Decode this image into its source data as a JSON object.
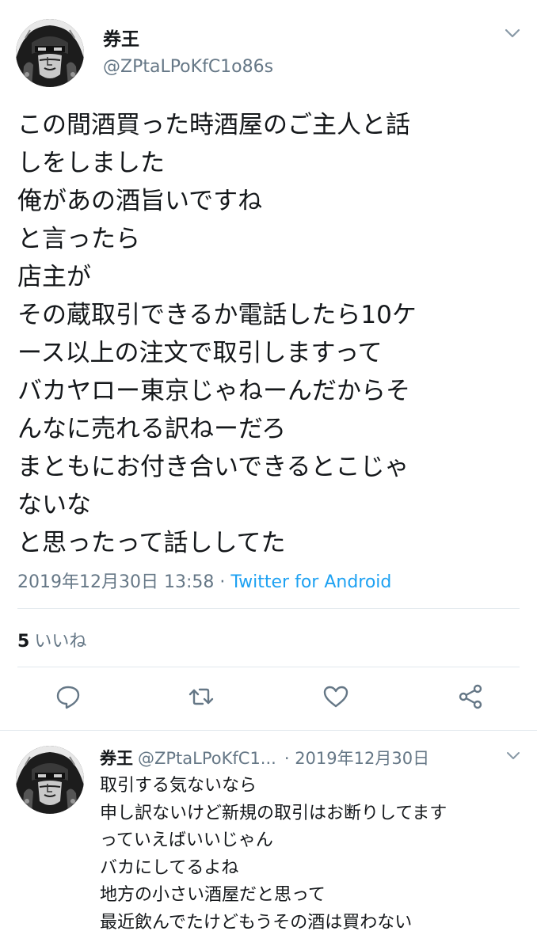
{
  "tweet": {
    "author": {
      "name": "券王",
      "handle": "@ZPtaLPoKfC1o86s"
    },
    "text_lines": [
      "この間酒買った時酒屋のご主人と話",
      "しをしました",
      "俺があの酒旨いですね",
      "と言ったら",
      "店主が",
      "その蔵取引できるか電話したら10ケ",
      "ース以上の注文で取引しますって",
      "バカヤロー東京じゃねーんだからそ",
      "んなに売れる訳ねーだろ",
      "まともにお付き合いできるとこじゃ",
      "ないな",
      "と思ったって話ししてた"
    ],
    "timestamp": "2019年12月30日 13:58",
    "separator": " · ",
    "source": "Twitter for Android",
    "likes_count": "5",
    "likes_label": "いいね"
  },
  "reply": {
    "author": {
      "name": "券王",
      "handle": "@ZPtaLPoKfC1...",
      "date": "· 2019年12月30日"
    },
    "text_lines": [
      "取引する気ないなら",
      "申し訳ないけど新規の取引はお断りしてます",
      "っていえばいいじゃん",
      "バカにしてるよね",
      "地方の小さい酒屋だと思って",
      "最近飲んでたけどもうその酒は買わない"
    ]
  },
  "icons": {
    "caret": "chevron-down-icon",
    "reply": "reply-icon",
    "retweet": "retweet-icon",
    "like": "heart-icon",
    "share": "share-icon",
    "avatar": "manga-portrait-avatar"
  },
  "colors": {
    "text": "#14171a",
    "secondary": "#657786",
    "link": "#1da1f2",
    "divider": "#e1e8ed",
    "icon": "#657786"
  }
}
